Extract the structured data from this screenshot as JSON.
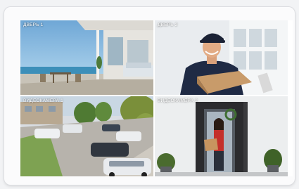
{
  "screen": {
    "tiles": [
      {
        "label": "ДВЕРЬ 1",
        "scene": "modern-house-patio"
      },
      {
        "label": "ДВЕРЬ 2",
        "scene": "delivery-man-with-box"
      },
      {
        "label": "ВИДЕОКАМЕРА 1",
        "scene": "parking-lot"
      },
      {
        "label": "ВИДЕОКАМЕРА 2",
        "scene": "woman-at-front-door"
      }
    ]
  },
  "colors": {
    "frame": "#fbfbfc",
    "label": "#ffffff"
  }
}
